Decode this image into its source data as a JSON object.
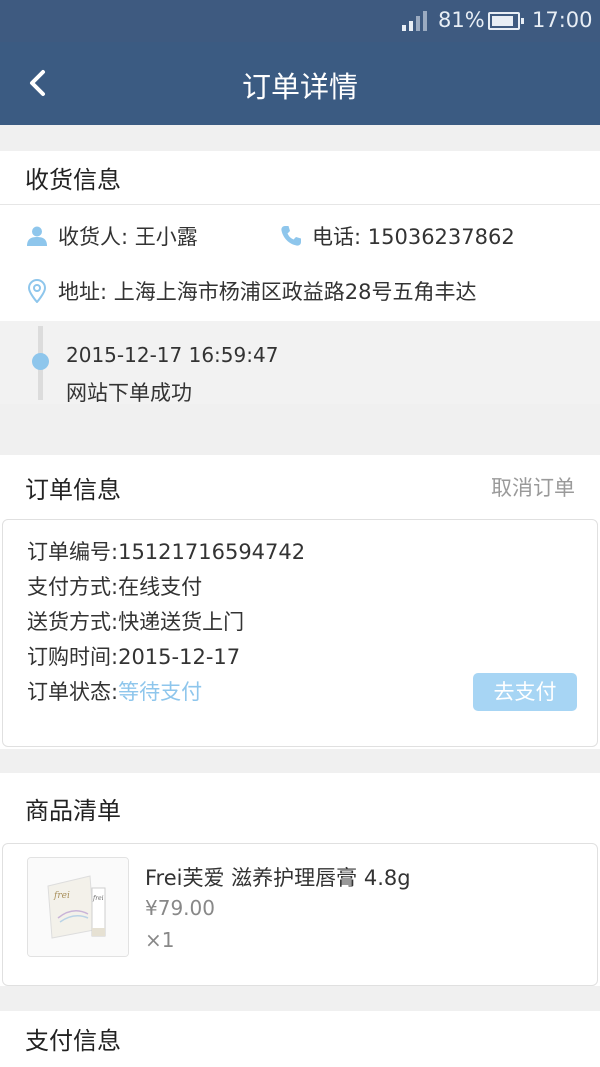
{
  "status_bar": {
    "battery": "81%",
    "time": "17:00"
  },
  "nav": {
    "title": "订单详情"
  },
  "shipping": {
    "title": "收货信息",
    "recipient_label": "收货人: 王小露",
    "phone_label": "电话: 15036237862",
    "address_label": "地址: 上海上海市杨浦区政益路28号五角丰达",
    "timeline": [
      {
        "date": "2015-12-17 16:59:47",
        "message": "网站下单成功"
      }
    ]
  },
  "order": {
    "title": "订单信息",
    "cancel_label": "取消订单",
    "number_key": "订单编号: ",
    "number_val": "15121716594742",
    "payment_key": "支付方式: ",
    "payment_val": "在线支付",
    "delivery_key": "送货方式: ",
    "delivery_val": "快递送货上门",
    "time_key": "订购时间: ",
    "time_val": "2015-12-17",
    "status_key": "订单状态: ",
    "status_val": "等待支付",
    "pay_button": "去支付"
  },
  "goods": {
    "title": "商品清单",
    "items": [
      {
        "name": "Frei芙爱 滋养护理唇膏 4.8g",
        "price": "¥79.00",
        "qty": "×1",
        "brand_mark": "frei"
      }
    ]
  },
  "payinfo": {
    "title": "支付信息"
  },
  "colors": {
    "nav": "#3b5b82",
    "accent": "#8ec6ec",
    "button": "#a7d5f4"
  },
  "icons": [
    "back-arrow-icon",
    "user-icon",
    "phone-icon",
    "location-pin-icon"
  ]
}
